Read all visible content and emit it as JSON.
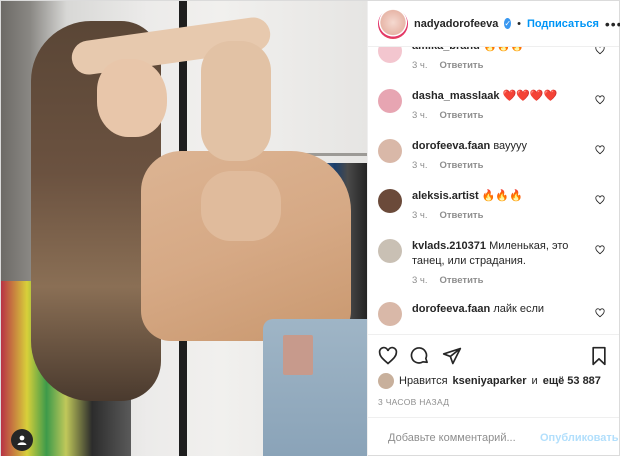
{
  "header": {
    "username": "nadyadorofeeva",
    "separator": "•",
    "follow_label": "Подписаться",
    "more_label": "•••"
  },
  "comments": [
    {
      "username": "amika_brand",
      "text": "🔥🔥🔥",
      "time": "3 ч.",
      "reply": "Ответить",
      "avatar_color": "#f3c6cf"
    },
    {
      "username": "dasha_masslaak",
      "text": "❤️❤️❤️❤️",
      "time": "3 ч.",
      "reply": "Ответить",
      "avatar_color": "#e7a5b2"
    },
    {
      "username": "dorofeeva.faan",
      "text": "вауууу",
      "time": "3 ч.",
      "reply": "Ответить",
      "avatar_color": "#d9b8a8"
    },
    {
      "username": "aleksis.artist",
      "text": "🔥🔥🔥",
      "time": "3 ч.",
      "reply": "Ответить",
      "avatar_color": "#6b4a3a"
    },
    {
      "username": "kvlads.210371",
      "text": "Миленькая, это танец, или страдания.",
      "time": "3 ч.",
      "reply": "Ответить",
      "avatar_color": "#c9c0b4"
    },
    {
      "username": "dorofeeva.faan",
      "text": "лайк если",
      "time": "",
      "reply": "",
      "avatar_color": "#d9b8a8"
    }
  ],
  "likes": {
    "prefix": "Нравится",
    "user": "kseniyaparker",
    "connector": "и",
    "count": "ещё 53 887"
  },
  "timestamp": "3 часов назад",
  "add_comment": {
    "placeholder": "Добавьте комментарий...",
    "publish_label": "Опубликовать"
  },
  "icons": {
    "like": "heart-icon",
    "comment": "comment-icon",
    "share": "share-icon",
    "save": "bookmark-icon",
    "emoji": "emoji-icon",
    "user_tag": "user-tag-icon"
  },
  "colors": {
    "accent": "#0095f6",
    "verified": "#3897f0",
    "muted": "#8e8e8e",
    "publish_disabled": "#b2dffc"
  }
}
